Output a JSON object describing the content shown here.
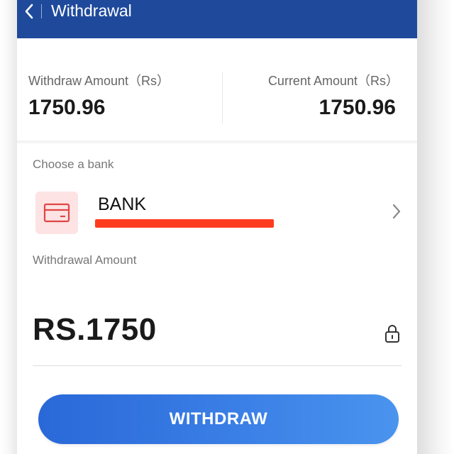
{
  "header": {
    "title": "Withdrawal",
    "back_icon": "chevron-left-icon"
  },
  "summary": {
    "withdraw_amount_label": "Withdraw Amount（Rs）",
    "withdraw_amount_value": "1750.96",
    "current_amount_label": "Current Amount（Rs）",
    "current_amount_value": "1750.96"
  },
  "bank": {
    "section_label": "Choose a bank",
    "name": "BANK",
    "icon": "credit-card-icon",
    "chevron_icon": "chevron-right-icon"
  },
  "withdrawal": {
    "label": "Withdrawal Amount",
    "amount": "RS.1750",
    "lock_icon": "lock-icon"
  },
  "actions": {
    "withdraw_label": "WITHDRAW"
  },
  "colors": {
    "header": "#1f4a9c",
    "button_start": "#2a68d8",
    "button_end": "#4a94ee",
    "redaction": "#ff3b1f",
    "card_icon_bg": "#fde3e3",
    "card_icon": "#e04545"
  }
}
